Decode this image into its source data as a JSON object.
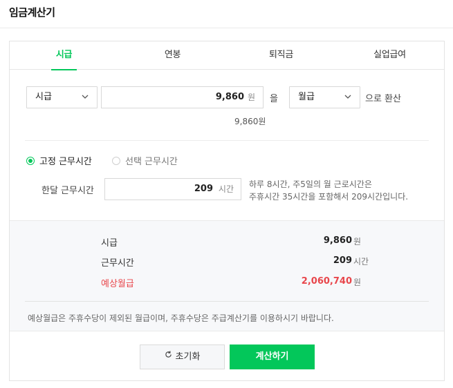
{
  "page": {
    "title": "임금계산기"
  },
  "tabs": [
    {
      "label": "시급",
      "active": true
    },
    {
      "label": "연봉",
      "active": false
    },
    {
      "label": "퇴직금",
      "active": false
    },
    {
      "label": "실업급여",
      "active": false
    }
  ],
  "conversion": {
    "from_select": "시급",
    "amount_value": "9,860",
    "amount_unit": "원",
    "particle_eul": "을",
    "to_select": "월급",
    "suffix": "으로 환산",
    "preview": "9,860원"
  },
  "work_time": {
    "radio_fixed": "고정 근무시간",
    "radio_choice": "선택 근무시간",
    "selected": "fixed",
    "label": "한달 근무시간",
    "value": "209",
    "unit": "시간",
    "help_line1": "하루 8시간, 주5일의 월 근로시간은",
    "help_line2": "주휴시간 35시간을 포함해서 209시간입니다."
  },
  "results": [
    {
      "label": "시급",
      "value": "9,860",
      "unit": "원",
      "highlight": false
    },
    {
      "label": "근무시간",
      "value": "209",
      "unit": "시간",
      "highlight": false
    },
    {
      "label": "예상월급",
      "value": "2,060,740",
      "unit": "원",
      "highlight": true
    }
  ],
  "notice": "예상월급은 주휴수당이 제외된 월급이며, 주휴수당은 주급계산기를 이용하시기 바랍니다.",
  "buttons": {
    "reset": "초기화",
    "calculate": "계산하기"
  },
  "colors": {
    "accent": "#03c75a",
    "highlight": "#e8464b"
  },
  "icons": {
    "chevron": "chevron-down-icon",
    "reset": "refresh-icon"
  }
}
